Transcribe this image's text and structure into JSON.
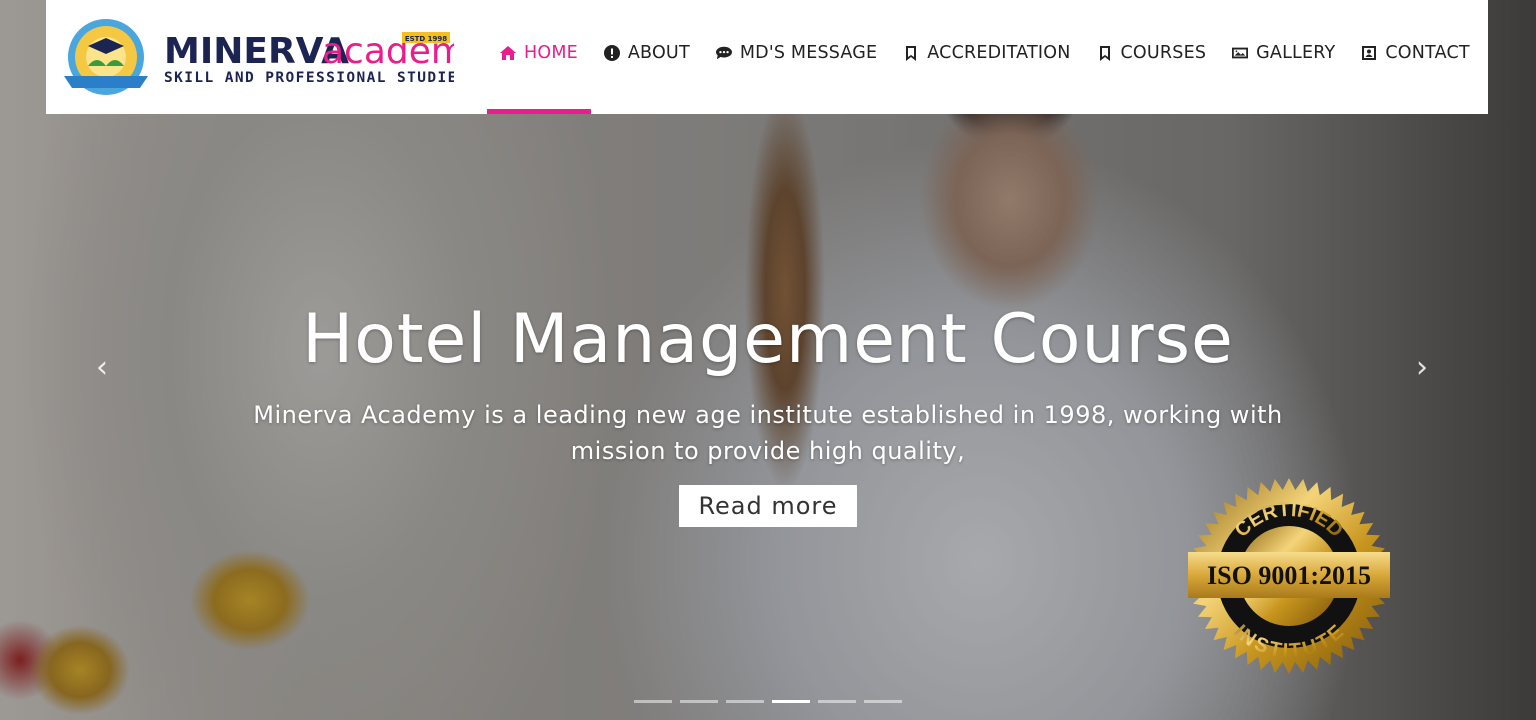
{
  "brand": {
    "name_bold": "MINERVA",
    "name_script": "academy",
    "tagline": "SKILL AND PROFESSIONAL STUDIES",
    "estd": "ESTD 1998",
    "accent": "#e91e8c",
    "navy": "#1c2452"
  },
  "nav": [
    {
      "label": "HOME",
      "icon": "home-icon",
      "active": true
    },
    {
      "label": "ABOUT",
      "icon": "info-circle-icon"
    },
    {
      "label": "MD'S MESSAGE",
      "icon": "comment-dots-icon"
    },
    {
      "label": "ACCREDITATION",
      "icon": "bookmark-icon"
    },
    {
      "label": "COURSES",
      "icon": "bookmark-icon"
    },
    {
      "label": "GALLERY",
      "icon": "image-icon"
    },
    {
      "label": "CONTACT",
      "icon": "contact-card-icon"
    }
  ],
  "slide": {
    "title": "Hotel Management Course",
    "text": "Minerva Academy is a leading new age institute established in 1998, working with mission to provide high quality,",
    "button": "Read more"
  },
  "carousel": {
    "prev": "‹",
    "next": "›",
    "count": 6,
    "active_index": 3
  },
  "seal": {
    "top": "CERTIFIED",
    "middle": "ISO 9001:2015",
    "bottom": "INSTITUTE"
  }
}
